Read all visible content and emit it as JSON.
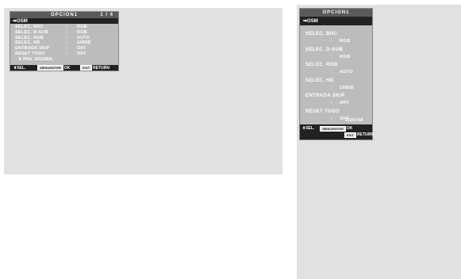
{
  "osd_small": {
    "title": "OPCION1",
    "page": "1 / 4",
    "osm": "OSM",
    "rows": [
      {
        "label": "SELEC. BNC",
        "sep": ":",
        "value": "RGB"
      },
      {
        "label": "SELEC. D-SUB",
        "sep": ":",
        "value": "RGB"
      },
      {
        "label": "SELEC. RGB",
        "sep": ":",
        "value": "AUTO"
      },
      {
        "label": "SELEC. HD",
        "sep": ":",
        "value": "1080B"
      },
      {
        "label": "ENTRADA SKIP",
        "sep": ":",
        "value": "OFF"
      },
      {
        "label": "RESET TODO",
        "sep": ":",
        "value": "OFF"
      }
    ],
    "next": "PAG. SIGUIEN.",
    "footer": {
      "sel": "SEL.",
      "key_ok": "MENU/ENTER",
      "ok": "OK",
      "key_return": "EXIT",
      "return": "RETURN"
    }
  },
  "osd_tall": {
    "title": "OPCION1",
    "osm": "OSM",
    "rows": [
      {
        "label": "SELEC. BNC",
        "sep": ":",
        "value": "RGB"
      },
      {
        "label": "SELEC. D-SUB",
        "sep": ":",
        "value": "RGB"
      },
      {
        "label": "SELEC. RGB",
        "sep": ":",
        "value": "AUTO"
      },
      {
        "label": "SELEC. HD",
        "sep": ":",
        "value": "1080B"
      },
      {
        "label": "ENTRADA SKIP",
        "sep": ":",
        "value": "OFF"
      },
      {
        "label": "RESET TODO",
        "sep": ":",
        "value": "OFF"
      }
    ],
    "resolution": "1024×768",
    "footer": {
      "sel": "SEL.",
      "key_ok": "MENU/ENTER",
      "ok": "OK",
      "key_return": "EXIT",
      "return": "RETURN"
    }
  },
  "colors": {
    "panel": "#e1e1e2",
    "osd_body": "#bcbcbc",
    "osd_bar": "#222222"
  }
}
